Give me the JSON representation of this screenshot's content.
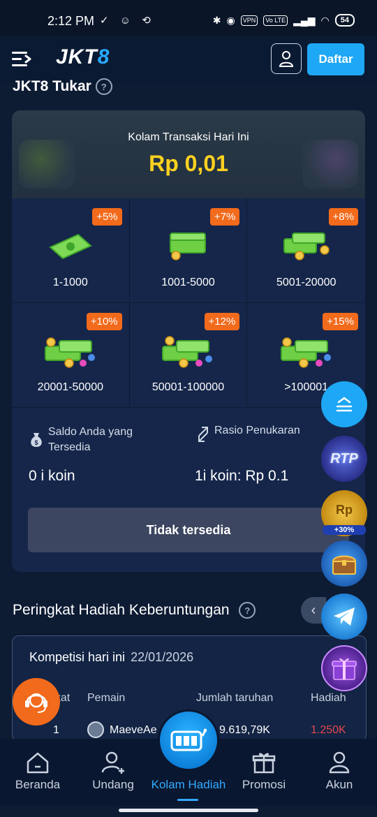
{
  "status": {
    "time": "2:12 PM",
    "left_icons": "✓ ☺ ⟲",
    "vpn_label": "VPN",
    "volte_label": "Vo LTE",
    "battery_level": "54"
  },
  "header": {
    "logo_main": "JKT",
    "logo_accent": "8",
    "register_label": "Daftar"
  },
  "tukar": {
    "title": "JKT8 Tukar",
    "pool_label": "Kolam Transaksi Hari Ini",
    "pool_amount": "Rp 0,01",
    "tiers": [
      {
        "bonus": "+5%",
        "range": "1-1000",
        "icon": "cash-icon"
      },
      {
        "bonus": "+7%",
        "range": "1001-5000",
        "icon": "cash-stack-icon"
      },
      {
        "bonus": "+8%",
        "range": "5001-20000",
        "icon": "cash-coins-icon"
      },
      {
        "bonus": "+10%",
        "range": "20001-50000",
        "icon": "cash-pile-icon"
      },
      {
        "bonus": "+12%",
        "range": "50001-100000",
        "icon": "cash-pile-icon"
      },
      {
        "bonus": "+15%",
        "range": ">100001",
        "icon": "cash-pile-icon"
      }
    ],
    "balance_label": "Saldo Anda yang Tersedia",
    "balance_value": "0 i koin",
    "ratio_label": "Rasio Penukaran",
    "ratio_value": "1i koin: Rp 0.1",
    "unavailable_label": "Tidak tersedia"
  },
  "ranking": {
    "title": "Peringkat Hadiah Keberuntungan",
    "competition_label": "Kompetisi hari ini",
    "date": "22/01/2026",
    "columns": {
      "rank": "gkat",
      "player": "Pemain",
      "bet": "Jumlah taruhan",
      "prize": "Hadiah"
    },
    "rows": [
      {
        "rank": "1",
        "player": "MaeveAe",
        "bet": "9.619,79K",
        "prize": "1.250K"
      }
    ]
  },
  "nav": {
    "items": [
      {
        "label": "Beranda",
        "icon": "home-icon"
      },
      {
        "label": "Undang",
        "icon": "add-user-icon"
      },
      {
        "label": "Kolam Hadiah",
        "icon": "slot-machine-icon"
      },
      {
        "label": "Promosi",
        "icon": "gift-icon"
      },
      {
        "label": "Akun",
        "icon": "person-icon"
      }
    ],
    "active": "Kolam Hadiah"
  },
  "floating": {
    "rtp_label": "RTP",
    "rp_label": "Rp",
    "rp_bonus": "+30%"
  },
  "colors": {
    "background": "#0d1b33",
    "accent": "#1ea7f5",
    "pool_amount": "#ffd21f",
    "badge": "#f26a1b",
    "prize": "#e5484d"
  }
}
